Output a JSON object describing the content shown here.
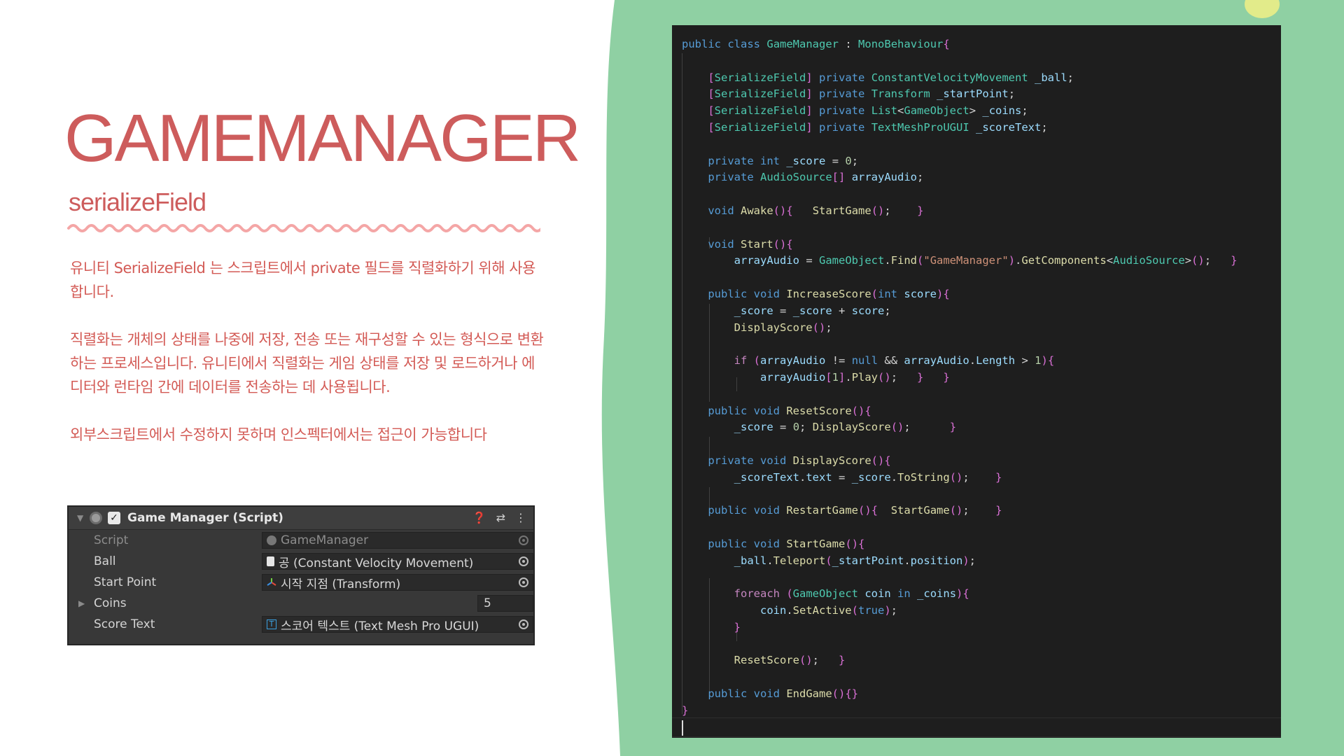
{
  "slide": {
    "title": "GAMEMANAGER",
    "subtitle": "serializeField",
    "paragraphs": [
      " 유니티 SerializeField 는 스크립트에서 private 필드를 직렬화하기 위해 사용합니다.",
      "직렬화는 개체의 상태를 나중에 저장, 전송 또는 재구성할 수 있는 형식으로 변환하는 프로세스입니다. 유니티에서 직렬화는 게임 상태를 저장 및 로드하거나 에디터와 런타임 간에 데이터를 전송하는 데 사용됩니다.",
      "외부스크립트에서 수정하지 못하며 인스펙터에서는 접근이 가능합니다"
    ],
    "colors": {
      "accent": "#cd5c5c",
      "wave": "#f4a6a6",
      "green_bg": "#8fd0a3",
      "dot": "#e2eb8a"
    }
  },
  "inspector": {
    "component_title": "Game Manager (Script)",
    "header_icons": [
      "help-icon",
      "preset-icon",
      "more-icon"
    ],
    "rows": [
      {
        "label": "Script",
        "value": "GameManager",
        "icon": "script-icon"
      },
      {
        "label": "Ball",
        "value": "공 (Constant Velocity Movement)",
        "icon": "script-file-icon"
      },
      {
        "label": "Start Point",
        "value": "시작 지점 (Transform)",
        "icon": "transform-icon"
      },
      {
        "label": "Coins",
        "value": "5"
      },
      {
        "label": "Score Text",
        "value": "스코어 텍스트 (Text Mesh Pro UGUI)",
        "icon": "textmeshpro-icon"
      }
    ]
  },
  "code": {
    "lines": [
      "public class GameManager : MonoBehaviour{",
      "",
      "    [SerializeField] private ConstantVelocityMovement _ball;",
      "    [SerializeField] private Transform _startPoint;",
      "    [SerializeField] private List<GameObject> _coins;",
      "    [SerializeField] private TextMeshProUGUI _scoreText;",
      "",
      "    private int _score = 0;",
      "    private AudioSource[] arrayAudio;",
      "",
      "    void Awake(){   StartGame();    }",
      "",
      "    void Start(){",
      "        arrayAudio = GameObject.Find(\"GameManager\").GetComponents<AudioSource>();   }",
      "",
      "    public void IncreaseScore(int score){",
      "        _score = _score + score;",
      "        DisplayScore();",
      "",
      "        if (arrayAudio != null && arrayAudio.Length > 1){",
      "            arrayAudio[1].Play();   }   }",
      "",
      "    public void ResetScore(){",
      "        _score = 0; DisplayScore();      }",
      "",
      "    private void DisplayScore(){",
      "        _scoreText.text = _score.ToString();    }",
      "",
      "    public void RestartGame(){  StartGame();    }",
      "",
      "    public void StartGame(){",
      "        _ball.Teleport(_startPoint.position);",
      "",
      "        foreach (GameObject coin in _coins){",
      "            coin.SetActive(true);",
      "        }",
      "",
      "        ResetScore();   }",
      "",
      "    public void EndGame(){}",
      "}"
    ]
  }
}
